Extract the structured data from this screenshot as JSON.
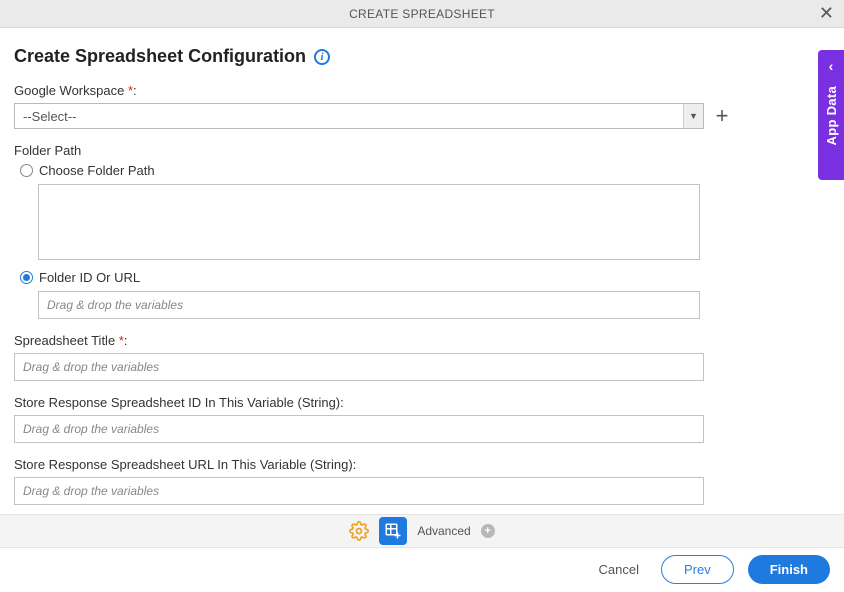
{
  "header": {
    "title": "CREATE SPREADSHEET"
  },
  "page_title": "Create Spreadsheet Configuration",
  "sidebar": {
    "label": "App Data"
  },
  "fields": {
    "google_workspace": {
      "label": "Google Workspace ",
      "required_mark": "*",
      "colon": ":",
      "selected": "--Select--"
    },
    "folder_path": {
      "label": "Folder Path",
      "choose_label": "Choose Folder Path",
      "id_url_label": "Folder ID Or URL",
      "id_url_placeholder": "Drag & drop the variables"
    },
    "spreadsheet_title": {
      "label": "Spreadsheet Title ",
      "required_mark": "*",
      "colon": ":",
      "placeholder": "Drag & drop the variables"
    },
    "store_id": {
      "label": "Store Response Spreadsheet ID In This Variable (String):",
      "placeholder": "Drag & drop the variables"
    },
    "store_url": {
      "label": "Store Response Spreadsheet URL In This Variable (String):",
      "placeholder": "Drag & drop the variables"
    }
  },
  "footer": {
    "advanced": "Advanced"
  },
  "buttons": {
    "cancel": "Cancel",
    "prev": "Prev",
    "finish": "Finish"
  }
}
